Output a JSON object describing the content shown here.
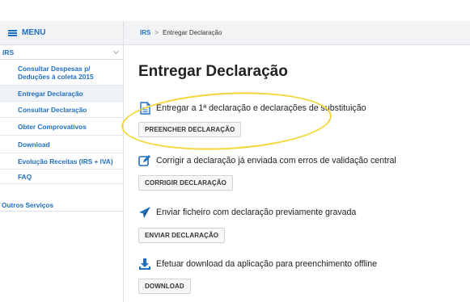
{
  "menu": {
    "label": "MENU"
  },
  "sidebar": {
    "section": "IRS",
    "items": [
      {
        "label": "Consultar Despesas p/ Deduções à coleta 2015"
      },
      {
        "label": "Entregar Declaração"
      },
      {
        "label": "Consultar Declaração"
      },
      {
        "label": "Obter Comprovativos"
      },
      {
        "label": "Download"
      },
      {
        "label": "Evolução Receitas (IRS + IVA)"
      },
      {
        "label": "FAQ"
      }
    ],
    "other": "Outros Serviços"
  },
  "breadcrumb": {
    "root": "IRS",
    "separator": ">",
    "current": "Entregar Declaração"
  },
  "page": {
    "title": "Entregar Declaração"
  },
  "actions": [
    {
      "icon": "document-icon",
      "text": "Entregar a 1ª declaração e declarações de substituição",
      "button": "PREENCHER DECLARAÇÃO"
    },
    {
      "icon": "edit-icon",
      "text": "Corrigir a declaração já enviada com erros de validação central",
      "button": "CORRIGIR DECLARAÇÃO"
    },
    {
      "icon": "send-icon",
      "text": "Enviar ficheiro com declaração previamente gravada",
      "button": "ENVIAR DECLARAÇÃO"
    },
    {
      "icon": "download-icon",
      "text": "Efetuar download da aplicação para preenchimento offline",
      "button": "DOWNLOAD"
    }
  ],
  "colors": {
    "accent": "#1f6fbf",
    "highlight": "#f5d63a"
  }
}
